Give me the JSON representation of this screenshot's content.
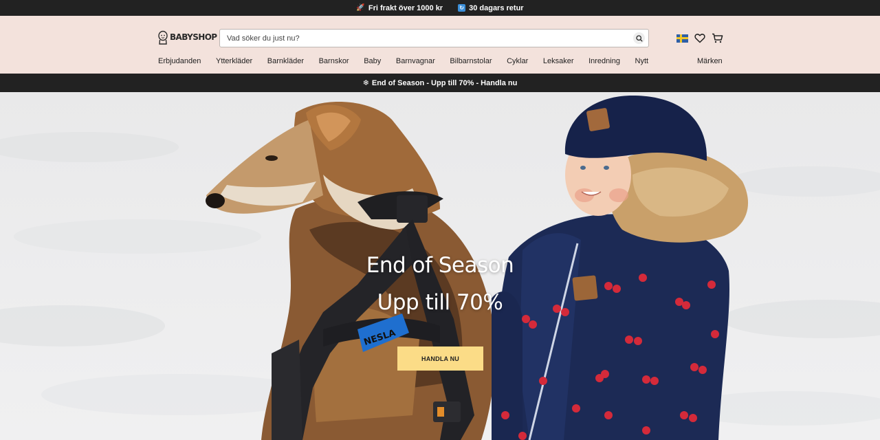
{
  "topbar": {
    "items": [
      {
        "icon": "rocket-icon",
        "text": "Fri frakt över 1000 kr"
      },
      {
        "icon": "return-icon",
        "text": "30 dagars retur"
      }
    ]
  },
  "header": {
    "logo_text": "BABYSHOP",
    "search_placeholder": "Vad söker du just nu?",
    "icons": [
      "swedish-flag-icon",
      "heart-icon",
      "cart-icon"
    ],
    "nav": [
      "Erbjudanden",
      "Ytterkläder",
      "Barnkläder",
      "Barnskor",
      "Baby",
      "Barnvagnar",
      "Bilbarnstolar",
      "Cyklar",
      "Leksaker",
      "Inredning",
      "Nytt"
    ],
    "brands_label": "Märken"
  },
  "promo": {
    "icon": "snowflake-icon",
    "text": "End of Season - Upp till 70% - Handla nu"
  },
  "hero": {
    "title": "End of Season",
    "subtitle": "Upp till 70%",
    "cta_label": "HANDLA NU",
    "harness_text": "NESLA"
  },
  "colors": {
    "topbar_bg": "#222222",
    "header_bg": "#f3e2dc",
    "cta_bg": "#fbdc87"
  }
}
